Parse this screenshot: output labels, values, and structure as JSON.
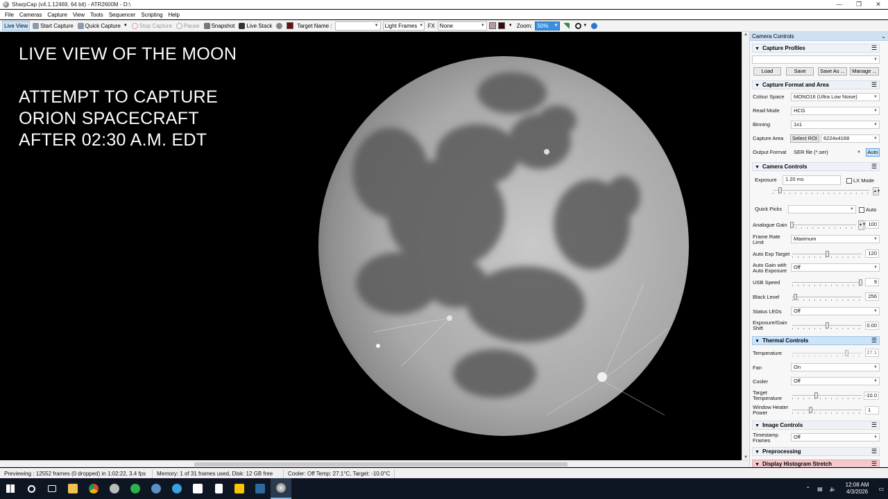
{
  "title_bar": {
    "title": "SharpCap (v4.1.12469, 64 bit) - ATR2600M - D:\\"
  },
  "menu": [
    "File",
    "Cameras",
    "Capture",
    "View",
    "Tools",
    "Sequencer",
    "Scripting",
    "Help"
  ],
  "toolbar": {
    "live_view": "Live View",
    "start_capture": "Start Capture",
    "quick_capture": "Quick Capture",
    "stop_capture": "Stop Capture",
    "pause": "Pause",
    "snapshot": "Snapshot",
    "live_stack": "Live Stack",
    "target_name_label": "Target Name :",
    "target_name_value": "",
    "frame_type": "Light Frames",
    "fx_label": "FX",
    "fx_value": "None",
    "zoom_label": "Zoom:",
    "zoom_value": "50%"
  },
  "overlay": {
    "line1": "LIVE VIEW OF THE MOON",
    "line2": "ATTEMPT TO CAPTURE",
    "line3": "ORION SPACECRAFT",
    "line4": "AFTER 02:30 A.M. EDT"
  },
  "panel": {
    "title": "Camera Controls",
    "capture_profiles": {
      "header": "Capture Profiles",
      "profile_value": "",
      "load": "Load",
      "save": "Save",
      "save_as": "Save As ...",
      "manage": "Manage ..."
    },
    "capture_format": {
      "header": "Capture Format and Area",
      "colour_space_label": "Colour Space",
      "colour_space": "MONO16 (Ultra Low Noise)",
      "read_mode_label": "Read Mode",
      "read_mode": "HCG",
      "binning_label": "Binning",
      "binning": "1x1",
      "capture_area_label": "Capture Area",
      "select_roi": "Select ROI",
      "capture_area": "6224x4168",
      "output_format_label": "Output Format",
      "output_format": "SER file (*.ser)",
      "auto": "Auto"
    },
    "camera_controls": {
      "header": "Camera Controls",
      "exposure_label": "Exposure",
      "exposure": "1.20 ms",
      "lx_mode": "LX Mode",
      "quick_picks_label": "Quick Picks",
      "quick_picks": "",
      "auto": "Auto",
      "analogue_gain_label": "Analogue Gain",
      "analogue_gain": "100",
      "frame_rate_label": "Frame Rate Limit",
      "frame_rate": "Maximum",
      "auto_exp_target_label": "Auto Exp Target",
      "auto_exp_target": "120",
      "auto_gain_label": "Auto Gain with Auto Exposure",
      "auto_gain": "Off",
      "usb_speed_label": "USB Speed",
      "usb_speed": "9",
      "black_level_label": "Black Level",
      "black_level": "256",
      "status_leds_label": "Status LEDs",
      "status_leds": "Off",
      "gain_shift_label": "Exposure/Gain Shift",
      "gain_shift": "0.00"
    },
    "thermal": {
      "header": "Thermal Controls",
      "temperature_label": "Temperature",
      "temperature": "27.1",
      "fan_label": "Fan",
      "fan": "On",
      "cooler_label": "Cooler",
      "cooler": "Off",
      "target_temp_label": "Target Temperature",
      "target_temp": "-10.0",
      "heater_label": "Window Heater Power",
      "heater": "1"
    },
    "image_controls": {
      "header": "Image Controls",
      "timestamp_label": "Timestamp Frames",
      "timestamp": "Off"
    },
    "preprocessing": {
      "header": "Preprocessing"
    },
    "histogram": {
      "header": "Display Histogram Stretch"
    }
  },
  "status_bar": {
    "preview": "Previewing : 12552 frames (0 dropped) in 1:02:22, 3.4 fps",
    "memory": "Memory: 1 of 31 frames used, Disk: 12 GB free",
    "cooler": "Cooler: Off Temp: 27.1°C, Target: -10.0°C"
  },
  "taskbar": {
    "time": "12:08 AM",
    "date": "4/3/2026"
  },
  "colors": {
    "accent_blue": "#cce4f7",
    "thermal_header": "#cce3f8",
    "histogram_header": "#f3c9cf",
    "taskbar": "#0d1622"
  }
}
